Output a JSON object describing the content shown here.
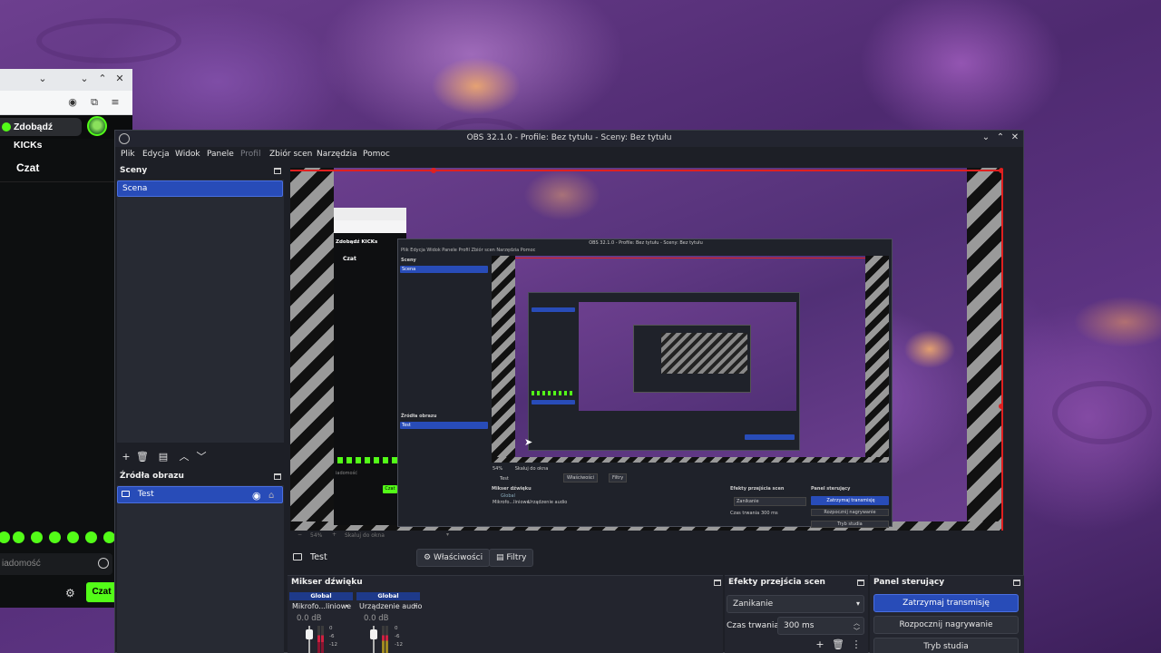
{
  "browser": {
    "kick_button": "Zdobądź KICKs",
    "chat_title": "Czat",
    "message_placeholder": "iadomość",
    "chat_send": "Czat"
  },
  "obs": {
    "window_title": "OBS 32.1.0 - Profile: Bez tytułu - Sceny: Bez tytułu",
    "menu": [
      "Plik",
      "Edycja",
      "Widok",
      "Panele",
      "Profil",
      "Zbiór scen",
      "Narzędzia",
      "Pomoc"
    ],
    "scenes": {
      "title": "Sceny",
      "items": [
        "Scena"
      ]
    },
    "sources": {
      "title": "Źródła obrazu",
      "items": [
        "Test"
      ]
    },
    "zoom": {
      "percent": "54%",
      "fit_label": "Skaluj do okna"
    },
    "source_toolbar": {
      "selected": "Test",
      "properties": "Właściwości",
      "filters": "Filtry"
    },
    "mixer": {
      "title": "Mikser dźwięku",
      "channels": [
        {
          "group": "Global",
          "name": "Mikrofo...liniowe",
          "db": "0.0 dB"
        },
        {
          "group": "Global",
          "name": "Urządzenie audio",
          "db": "0.0 dB"
        }
      ],
      "scale": [
        "0",
        "-6",
        "-12"
      ]
    },
    "transitions": {
      "title": "Efekty przejścia scen",
      "selected": "Zanikanie",
      "duration_label": "Czas trwania",
      "duration_value": "300 ms"
    },
    "controls": {
      "title": "Panel sterujący",
      "stop_stream": "Zatrzymaj transmisję",
      "start_recording": "Rozpocznij nagrywanie",
      "studio_mode": "Tryb studia"
    },
    "nested": {
      "window_title": "OBS 32.1.0 - Profile: Bez tytułu - Sceny: Bez tytułu",
      "menu": "Plik  Edycja  Widok  Panele  Profil  Zbiór scen  Narzędzia  Pomoc",
      "kick_button": "Zdobądź KICKs",
      "chat_title": "Czat",
      "message_placeholder": "iadomość",
      "chat_send": "Czat",
      "scenes_title": "Sceny",
      "scene_item": "Scena",
      "sources_title": "Źródła obrazu",
      "source_item": "Test",
      "src_selected": "Test",
      "properties": "Właściwości",
      "filters": "Filtry",
      "mixer_title": "Mikser dźwięku",
      "mixer_global": "Global",
      "mixer_ch1": "Mikrofo...liniowe",
      "mixer_ch2": "Urządzenie audio",
      "transitions_title": "Efekty przejścia scen",
      "transition_selected": "Zanikanie",
      "duration_label": "Czas trwania",
      "duration_value": "300 ms",
      "controls_title": "Panel sterujący",
      "stop_stream": "Zatrzymaj transmisję",
      "start_recording": "Rozpocznij nagrywanie",
      "studio_mode": "Tryb studia",
      "zoom_percent": "54%",
      "zoom_fit": "Skaluj do okna"
    }
  },
  "colors": {
    "accent_blue": "#284cb8",
    "kick_green": "#53fc18",
    "preview_border_red": "#e02020",
    "panel_bg": "#1d1f26"
  }
}
